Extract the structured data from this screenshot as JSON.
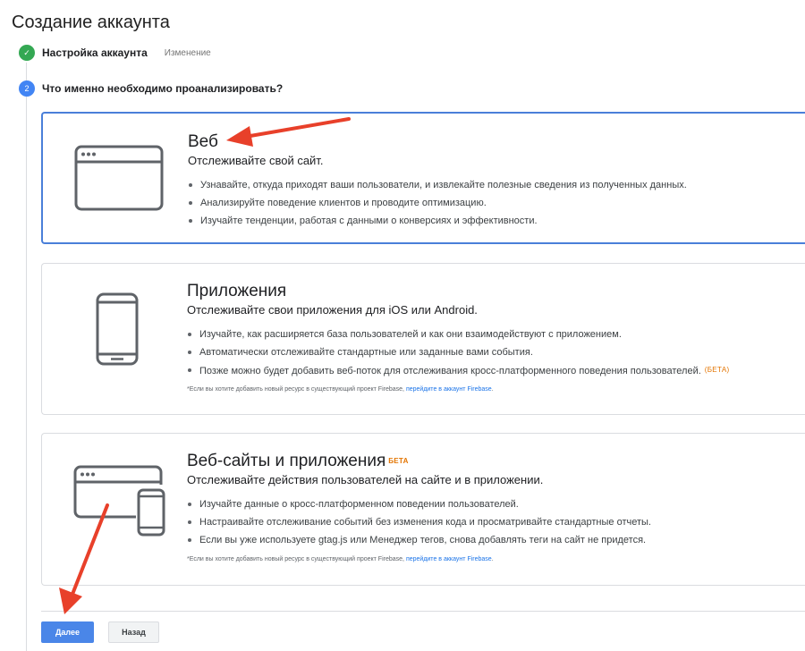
{
  "page": {
    "title": "Создание аккаунта"
  },
  "steps": [
    {
      "number": "✓",
      "label": "Настройка аккаунта",
      "edit_link": "Изменение",
      "status": "done"
    },
    {
      "number": "2",
      "label": "Что именно необходимо проанализировать?",
      "status": "current"
    }
  ],
  "options": {
    "web": {
      "icon": "browser-window-icon",
      "title": "Веб",
      "subtitle": "Отслеживайте свой сайт.",
      "selected": true,
      "bullets": [
        "Узнавайте, откуда приходят ваши пользователи, и извлекайте полезные сведения из полученных данных.",
        "Анализируйте поведение клиентов и проводите оптимизацию.",
        "Изучайте тенденции, работая с данными о конверсиях и эффективности."
      ]
    },
    "apps": {
      "icon": "mobile-phone-icon",
      "title": "Приложения",
      "subtitle": "Отслеживайте свои приложения для iOS или Android.",
      "bullets": [
        "Изучайте, как расширяется база пользователей и как они взаимодействуют с приложением.",
        "Автоматически отслеживайте стандартные или заданные вами события.",
        "Позже можно будет добавить веб-поток для отслеживания кросс-платформенного поведения пользователей."
      ],
      "bullet_badge": "(БЕТА)",
      "footnote": "*Если вы хотите добавить новый ресурс в существующий проект Firebase,",
      "footnote_link": "перейдите в аккаунт Firebase"
    },
    "web_and_apps": {
      "icon": "browser-and-phone-icon",
      "title": "Веб-сайты и приложения",
      "title_badge": "БЕТА",
      "subtitle": "Отслеживайте действия пользователей на сайте и в приложении.",
      "bullets": [
        "Изучайте данные о кросс-платформенном поведении пользователей.",
        "Настраивайте отслеживание событий без изменения кода и просматривайте стандартные отчеты.",
        "Если вы уже используете gtag.js или Менеджер тегов, снова добавлять теги на сайт не придется."
      ],
      "footnote": "*Если вы хотите добавить новый ресурс в существующий проект Firebase,",
      "footnote_link": "перейдите в аккаунт Firebase"
    }
  },
  "buttons": {
    "next": "Далее",
    "back": "Назад"
  },
  "colors": {
    "selected_border": "#4a7fd9",
    "primary_button": "#4a86e8",
    "step_done": "#34a853",
    "step_current": "#4285f4",
    "beta": "#e37400",
    "annotation_arrow": "#e8402a"
  }
}
